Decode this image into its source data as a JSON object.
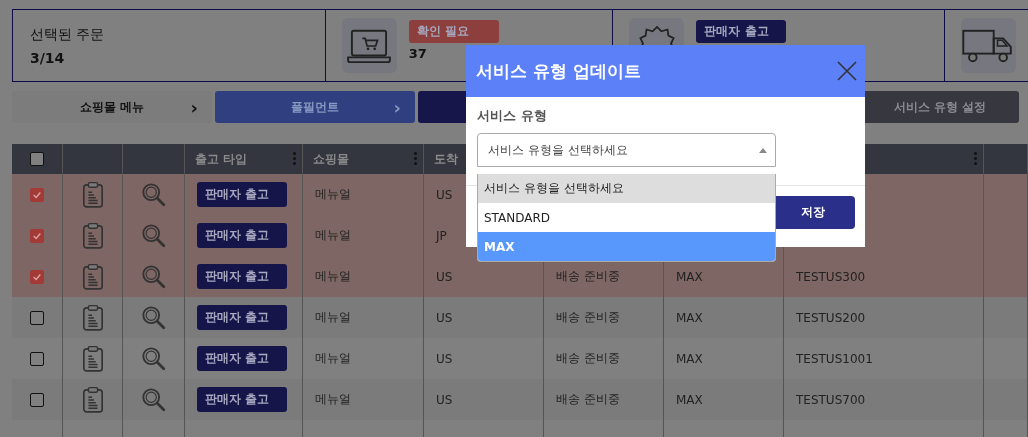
{
  "summary_cards": [
    {
      "kind": "text",
      "label": "선택된 주문",
      "value": "3/14"
    },
    {
      "kind": "cart",
      "badge": "확인 필요",
      "color": "#8c3f3c",
      "value": "37"
    },
    {
      "kind": "seal",
      "badge": "판매자 출고",
      "color": "#15154a"
    },
    {
      "kind": "truck"
    }
  ],
  "menu_buttons": [
    {
      "label": "쇼핑몰 메뉴",
      "color": "#7c7c7c",
      "arrow": "›"
    },
    {
      "label": "풀필먼트",
      "color": "#2f3f80",
      "arrow": "›"
    },
    {
      "color": "#16164a"
    },
    {
      "label": "서비스 유형 설정",
      "color": "#36373f"
    }
  ],
  "table": {
    "columns": [
      {
        "kind": "checkbox",
        "checked": false
      },
      {
        "kind": "blank"
      },
      {
        "kind": "blank"
      },
      {
        "label": "출고 타입",
        "menu": true
      },
      {
        "label": "쇼핑몰",
        "menu": true
      },
      {
        "label": "도착"
      },
      {
        "kind": "blank"
      },
      {
        "kind": "blank"
      },
      {
        "kind": "blank",
        "menu": true
      },
      {
        "kind": "blank"
      }
    ],
    "rows": [
      {
        "checked": true,
        "type": "판매자 출고",
        "mall": "메뉴얼",
        "country": "US"
      },
      {
        "checked": true,
        "type": "판매자 출고",
        "mall": "메뉴얼",
        "country": "JP"
      },
      {
        "checked": true,
        "type": "판매자 출고",
        "mall": "메뉴얼",
        "country": "US",
        "status": "배송 준비중",
        "service": "MAX",
        "order": "TESTUS300"
      },
      {
        "checked": false,
        "type": "판매자 출고",
        "mall": "메뉴얼",
        "country": "US",
        "status": "배송 준비중",
        "service": "MAX",
        "order": "TESTUS200"
      },
      {
        "checked": false,
        "type": "판매자 출고",
        "mall": "메뉴얼",
        "country": "US",
        "status": "배송 준비중",
        "service": "MAX",
        "order": "TESTUS1001"
      },
      {
        "checked": false,
        "type": "판매자 출고",
        "mall": "메뉴얼",
        "country": "US",
        "status": "배송 준비중",
        "service": "MAX",
        "order": "TESTUS700"
      }
    ]
  },
  "modal": {
    "title": "서비스 유형 업데이트",
    "field_label": "서비스 유형",
    "select": {
      "placeholder": "서비스 유형을 선택하세요",
      "expanded": true,
      "options": [
        {
          "label": "서비스 유형을 선택하세요",
          "selected": true,
          "highlighted": false
        },
        {
          "label": "STANDARD",
          "selected": false,
          "highlighted": false
        },
        {
          "label": "MAX",
          "selected": false,
          "highlighted": true
        }
      ]
    },
    "save_button": "저장"
  }
}
